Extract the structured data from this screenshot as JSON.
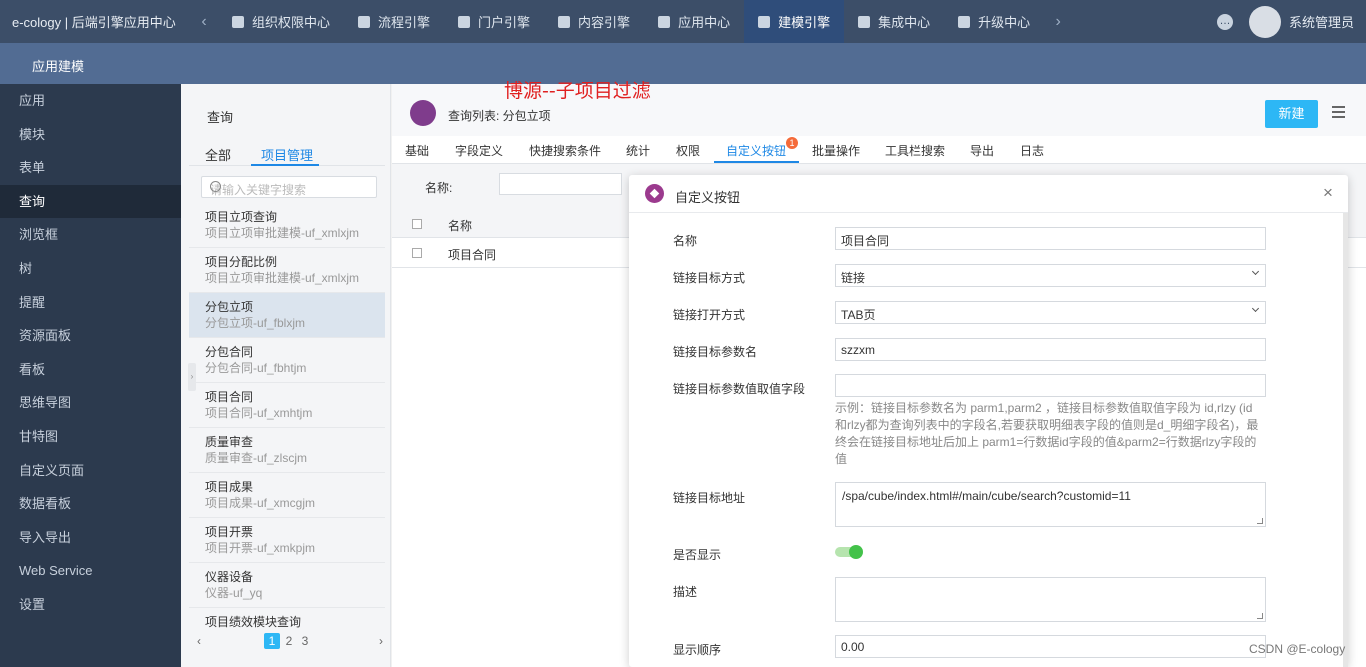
{
  "topbar": {
    "brand": "e-cology | 后端引擎应用中心",
    "prev_arrow": "‹",
    "next_arrow": "›",
    "nav": [
      {
        "label": "组织权限中心"
      },
      {
        "label": "流程引擎"
      },
      {
        "label": "门户引擎"
      },
      {
        "label": "内容引擎"
      },
      {
        "label": "应用中心"
      },
      {
        "label": "建模引擎",
        "active": true
      },
      {
        "label": "集成中心"
      },
      {
        "label": "升级中心"
      }
    ],
    "more": "…",
    "username": "系统管理员"
  },
  "subbar": {
    "title": "应用建模"
  },
  "sidebar": {
    "items": [
      "应用",
      "模块",
      "表单",
      "查询",
      "浏览框",
      "树",
      "提醒",
      "资源面板",
      "看板",
      "思维导图",
      "甘特图",
      "自定义页面",
      "数据看板",
      "导入导出",
      "Web Service",
      "设置"
    ],
    "active_index": 3
  },
  "midcol": {
    "title": "查询",
    "tabs": [
      "全部",
      "项目管理"
    ],
    "search_placeholder": "请输入关键字搜索",
    "items": [
      {
        "name": "项目立项查询",
        "sub": "项目立项审批建模-uf_xmlxjm"
      },
      {
        "name": "项目分配比例",
        "sub": "项目立项审批建模-uf_xmlxjm"
      },
      {
        "name": "分包立项",
        "sub": "分包立项-uf_fblxjm",
        "active": true
      },
      {
        "name": "分包合同",
        "sub": "分包合同-uf_fbhtjm"
      },
      {
        "name": "项目合同",
        "sub": "项目合同-uf_xmhtjm"
      },
      {
        "name": "质量审查",
        "sub": "质量审查-uf_zlscjm"
      },
      {
        "name": "项目成果",
        "sub": "项目成果-uf_xmcgjm"
      },
      {
        "name": "项目开票",
        "sub": "项目开票-uf_xmkpjm"
      },
      {
        "name": "仪器设备",
        "sub": "仪器-uf_yq"
      },
      {
        "name": "项目绩效模块查询",
        "sub": ""
      }
    ],
    "pager": {
      "prev": "‹",
      "pages": [
        "1",
        "2",
        "3"
      ],
      "next": "›",
      "current": "1"
    }
  },
  "main": {
    "title": "查询列表: 分包立项",
    "new_button": "新建",
    "tabs": [
      "基础",
      "字段定义",
      "快捷搜索条件",
      "统计",
      "权限",
      "自定义按钮",
      "批量操作",
      "工具栏搜索",
      "导出",
      "日志"
    ],
    "active_tab": "自定义按钮",
    "badge": "1",
    "filter_label": "名称:",
    "table_header": "名称",
    "table_rows": [
      "项目合同"
    ]
  },
  "overlay_text": "博源--子项目过滤",
  "modal": {
    "title": "自定义按钮",
    "close": "×",
    "fields": {
      "name_label": "名称",
      "name_value": "项目合同",
      "link_mode_label": "链接目标方式",
      "link_mode_value": "链接",
      "open_mode_label": "链接打开方式",
      "open_mode_value": "TAB页",
      "param_name_label": "链接目标参数名",
      "param_name_value": "szzxm",
      "param_field_label": "链接目标参数值取值字段",
      "param_field_value": "",
      "hint": "示例：链接目标参数名为 parm1,parm2 ，链接目标参数值取值字段为 id,rlzy (id和rlzy都为查询列表中的字段名,若要获取明细表字段的值则是d_明细字段名)，最终会在链接目标地址后加上 parm1=行数据id字段的值&parm2=行数据rlzy字段的值",
      "url_label": "链接目标地址",
      "url_value": "/spa/cube/index.html#/main/cube/search?customid=11",
      "show_label": "是否显示",
      "show_on": true,
      "desc_label": "描述",
      "desc_value": "",
      "order_label": "显示顺序",
      "order_value": "0.00"
    }
  },
  "watermark": "CSDN @E-cology",
  "colors": {
    "topbar": "#3c4e68",
    "subbar": "#526c93",
    "sidebar": "#2c3a4e",
    "accent": "#2db7f5",
    "active_tab": "#1e88e5",
    "toggle": "#43c24a",
    "overlay": "#e02020"
  }
}
